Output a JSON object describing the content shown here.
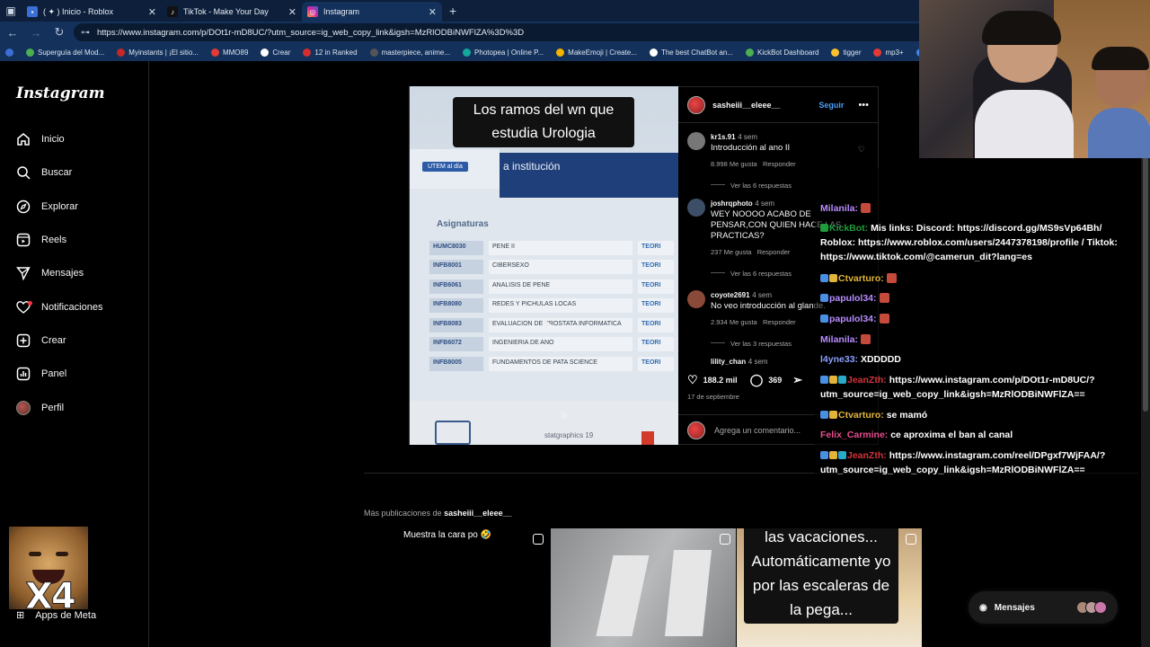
{
  "browser": {
    "tabs": [
      {
        "label": "( ✦ ) Inicio - Roblox",
        "active": false
      },
      {
        "label": "TikTok - Make Your Day",
        "active": false
      },
      {
        "label": "Instagram",
        "active": true
      }
    ],
    "url": "https://www.instagram.com/p/DOt1r-mD8UC/?utm_source=ig_web_copy_link&igsh=MzRlODBiNWFlZA%3D%3D",
    "bookmarks": [
      "Superguía del Mod...",
      "Myinstants | ¡El sitio...",
      "MMO89",
      "Crear",
      "12 in Ranked",
      "masterpiece, anime...",
      "Photopea | Online P...",
      "MakeEmoji | Create...",
      "The best ChatBot an...",
      "KickBot Dashboard",
      "tigger",
      "mp3+",
      "co"
    ]
  },
  "sidebar": {
    "brand": "Instagram",
    "items": [
      {
        "label": "Inicio",
        "icon": "home-icon"
      },
      {
        "label": "Buscar",
        "icon": "search-icon"
      },
      {
        "label": "Explorar",
        "icon": "compass-icon"
      },
      {
        "label": "Reels",
        "icon": "reels-icon"
      },
      {
        "label": "Mensajes",
        "icon": "send-icon"
      },
      {
        "label": "Notificaciones",
        "icon": "heart-icon"
      },
      {
        "label": "Crear",
        "icon": "plus-square-icon"
      },
      {
        "label": "Panel",
        "icon": "chart-icon"
      },
      {
        "label": "Perfil",
        "icon": "profile-avatar"
      }
    ],
    "meta_apps": "Apps de Meta"
  },
  "post": {
    "caption_overlay": "Los ramos del wn que estudia Urologia",
    "utem": "UTEM al día",
    "institution": "a institución",
    "asignaturas_title": "Asignaturas",
    "courses": [
      {
        "code": "HUMC8030",
        "name": "PENE II",
        "type": "TEORI"
      },
      {
        "code": "INFB8001",
        "name": "CIBERSEXO",
        "type": "TEORI"
      },
      {
        "code": "INFB6061",
        "name": "ANALISIS DE PENE",
        "type": "TEORI"
      },
      {
        "code": "INFB8080",
        "name": "REDES Y PICHULAS LOCAS",
        "type": "TEORI"
      },
      {
        "code": "INFB8083",
        "name": "EVALUACION DE PROSTATA INFORMATICA",
        "type": "TEORI"
      },
      {
        "code": "INFB6072",
        "name": "INGENIERIA DE ANO",
        "type": "TEORI"
      },
      {
        "code": "INFB8005",
        "name": "FUNDAMENTOS DE PATA SCIENCE",
        "type": "TEORI"
      }
    ],
    "statgraphics": "statgraphics 19",
    "author": "sasheiii__eleee__",
    "follow": "Seguir",
    "comments": [
      {
        "user": "kr1s.91",
        "time": "4 sem",
        "text": "Introducción al ano II",
        "likes": "8.998 Me gusta",
        "reply": "Responder",
        "replies": "Ver las 6 respuestas"
      },
      {
        "user": "joshrqphoto",
        "time": "4 sem",
        "text": "WEY NOOOO ACABO DE PENSAR,CON QUIEN HACE LAS PRACTICAS?",
        "likes": "237 Me gusta",
        "reply": "Responder",
        "replies": "Ver las 6 respuestas"
      },
      {
        "user": "coyote2691",
        "time": "4 sem",
        "text": "No veo introducción al glande.",
        "likes": "2.934 Me gusta",
        "reply": "Responder",
        "replies": "Ver las 3 respuestas"
      },
      {
        "user": "lility_chan",
        "time": "4 sem",
        "text": "",
        "likes": "",
        "reply": "",
        "replies": ""
      }
    ],
    "like_count": "188.2 mil",
    "comment_count": "369",
    "date": "17 de septiembre",
    "add_comment_placeholder": "Agrega un comentario..."
  },
  "more": {
    "prefix": "Más publicaciones de",
    "user": "sasheiii__eleee__",
    "thumbs": [
      {
        "caption": "Muestra la cara po 🤣"
      },
      {
        "caption": ""
      },
      {
        "caption": "las vacaciones... Automáticamente yo por las escaleras de la pega..."
      }
    ]
  },
  "messages_pill": "Mensajes",
  "chat": [
    {
      "user": "Milanila:",
      "color": "#b78cff",
      "text": ""
    },
    {
      "user": "KickBot:",
      "color": "#1f9b3b",
      "text": "Mis links: Discord: https://discord.gg/MS9sVp64Bh/ Roblox: https://www.roblox.com/users/2447378198/profile / Tiktok: https://www.tiktok.com/@camerun_dit?lang=es"
    },
    {
      "user": "Ctvarturo:",
      "color": "#e2b43a",
      "text": ""
    },
    {
      "user": "papulol34:",
      "color": "#b78cff",
      "text": ""
    },
    {
      "user": "papulol34:",
      "color": "#b78cff",
      "text": ""
    },
    {
      "user": "Milanila:",
      "color": "#b78cff",
      "text": ""
    },
    {
      "user": "l4yne33:",
      "color": "#8aa0ff",
      "text": "XDDDDD"
    },
    {
      "user": "JeanZth:",
      "color": "#d4333a",
      "text": "https://www.instagram.com/p/DOt1r-mD8UC/?utm_source=ig_web_copy_link&igsh=MzRlODBiNWFlZA=="
    },
    {
      "user": "Ctvarturo:",
      "color": "#e2b43a",
      "text": "se mamó"
    },
    {
      "user": "Felix_Carmine:",
      "color": "#e64d8c",
      "text": "ce aproxima el ban al canal"
    },
    {
      "user": "JeanZth:",
      "color": "#d4333a",
      "text": "https://www.instagram.com/reel/DPgxf7WjFAA/?utm_source=ig_web_copy_link&igsh=MzRlODBiNWFlZA=="
    }
  ],
  "emote_overlay": "X4"
}
